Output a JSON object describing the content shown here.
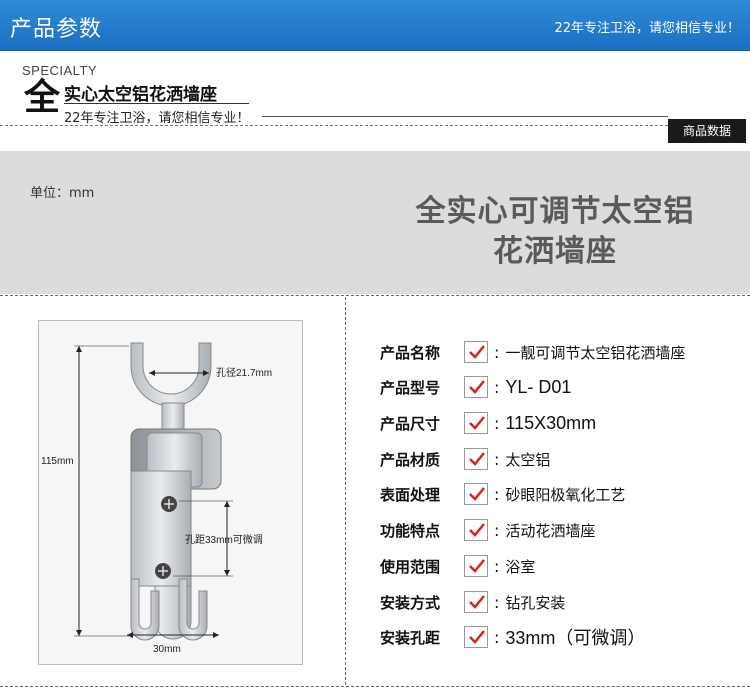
{
  "header": {
    "title": "产品参数",
    "slogan": "22年专注卫浴，请您相信专业！"
  },
  "specialty": {
    "en": "SPECIALTY",
    "big_char": "全",
    "title": "实心太空铝花洒墙座",
    "slogan": "22年专注卫浴，请您相信专业！",
    "tab": "商品数据"
  },
  "panel": {
    "unit": "单位：mm",
    "title_line1": "全实心可调节太空铝",
    "title_line2": "花洒墙座"
  },
  "diagram": {
    "hole_dia": "孔径21.7mm",
    "height": "115mm",
    "hole_dist": "孔距33mm可微调",
    "width": "30mm"
  },
  "specs": [
    {
      "label": "产品名称",
      "value": "一靓可调节太空铝花洒墙座"
    },
    {
      "label": "产品型号",
      "value": "YL- D01"
    },
    {
      "label": "产品尺寸",
      "value": "115X30mm"
    },
    {
      "label": "产品材质",
      "value": "太空铝"
    },
    {
      "label": "表面处理",
      "value": "砂眼阳极氧化工艺"
    },
    {
      "label": "功能特点",
      "value": "活动花洒墙座"
    },
    {
      "label": "使用范围",
      "value": "浴室"
    },
    {
      "label": "安装方式",
      "value": "钻孔安装"
    },
    {
      "label": "安装孔距",
      "value": "33mm（可微调）"
    }
  ],
  "colors": {
    "header_blue": "#1f74c6",
    "check_red": "#d6231c",
    "panel_grey": "#dcdcdc"
  }
}
